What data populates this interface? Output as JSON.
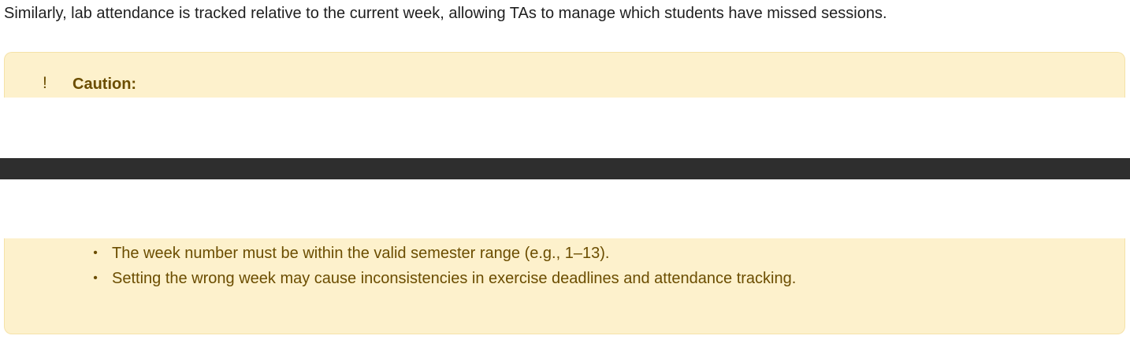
{
  "document": {
    "intro": "Similarly, lab attendance is tracked relative to the current week, allowing TAs to manage which students have missed sessions."
  },
  "callout": {
    "type": "caution",
    "icon": "exclamation-icon",
    "icon_glyph": "!",
    "title": "Caution:",
    "bullet_glyph": "•",
    "items": [
      "The week number must be within the valid semester range (e.g., 1–13).",
      "Setting the wrong week may cause inconsistencies in exercise deadlines and attendance tracking."
    ],
    "colors": {
      "background": "#fdf1cc",
      "text": "#6b4d00",
      "border": "#f5e2a8"
    }
  },
  "overlay": {
    "bar_color": "#2e2e2e"
  }
}
